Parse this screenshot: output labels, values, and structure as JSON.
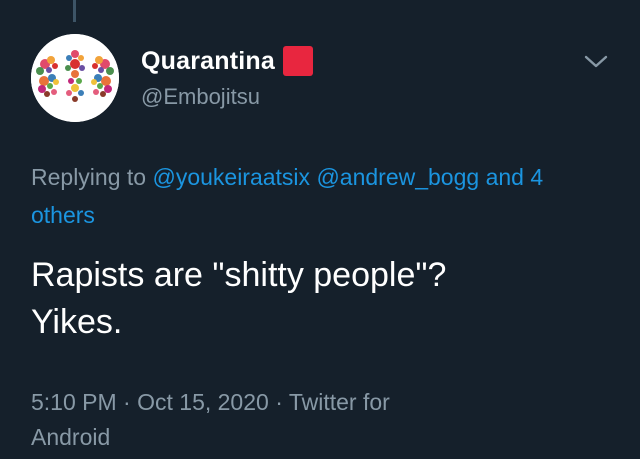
{
  "tweet": {
    "author": {
      "display_name": "Quarantina",
      "handle": "@Embojitsu",
      "badge_color": "#e8263f",
      "avatar_icon": "floral-pattern-avatar"
    },
    "menu_icon": "chevron-down-icon",
    "replying_prefix": "Replying to",
    "replying_to": [
      "@youkeiraatsix",
      "@andrew_bogg"
    ],
    "replying_others": "and 4 others",
    "text_line1": "Rapists are \"shitty people\"?",
    "text_line2": "Yikes.",
    "time": "5:10 PM",
    "date": "Oct 15, 2020",
    "source_line1": "Twitter for",
    "source_line2": "Android",
    "separator": "·"
  },
  "colors": {
    "background": "#15202b",
    "primary_text": "#ffffff",
    "secondary_text": "#8899a6",
    "link": "#1b95e0"
  }
}
